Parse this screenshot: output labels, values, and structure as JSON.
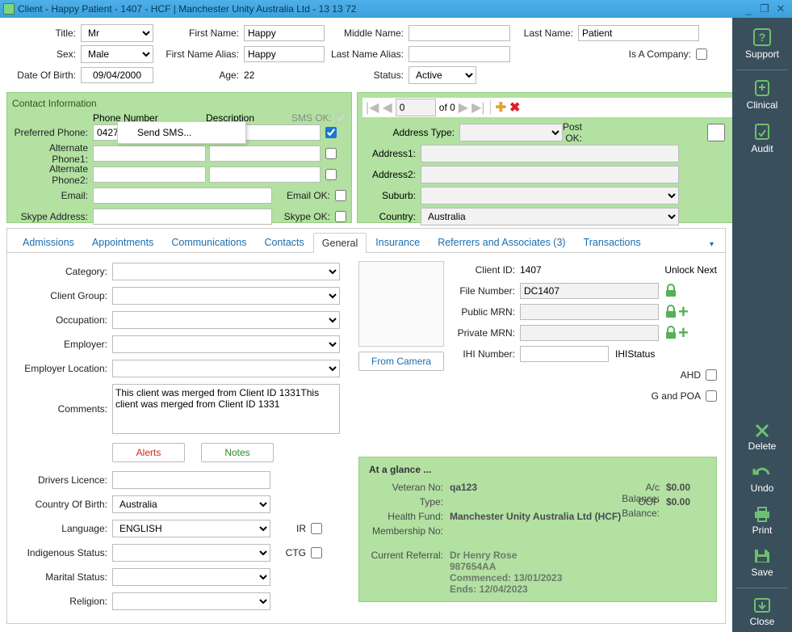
{
  "window": {
    "title": "Client - Happy Patient - 1407 - HCF | Manchester Unity Australia Ltd - 13 13 72"
  },
  "sidebar": {
    "support": "Support",
    "clinical": "Clinical",
    "audit": "Audit",
    "delete": "Delete",
    "undo": "Undo",
    "print": "Print",
    "save": "Save",
    "close": "Close"
  },
  "top": {
    "title_lbl": "Title:",
    "title_val": "Mr",
    "first_name_lbl": "First Name:",
    "first_name_val": "Happy",
    "middle_name_lbl": "Middle Name:",
    "middle_name_val": "",
    "last_name_lbl": "Last Name:",
    "last_name_val": "Patient",
    "sex_lbl": "Sex:",
    "sex_val": "Male",
    "first_alias_lbl": "First Name Alias:",
    "first_alias_val": "Happy",
    "last_alias_lbl": "Last Name Alias:",
    "last_alias_val": "",
    "is_company_lbl": "Is A Company:",
    "dob_lbl": "Date Of Birth:",
    "dob_val": "09/04/2000",
    "age_lbl": "Age:",
    "age_val": "22",
    "status_lbl": "Status:",
    "status_val": "Active"
  },
  "contact": {
    "header": "Contact Information",
    "phone_hdr": "Phone Number",
    "desc_hdr": "Description",
    "sms_ok": "SMS OK:",
    "preferred_lbl": "Preferred Phone:",
    "preferred_val": "0427",
    "alt1_lbl": "Alternate Phone1:",
    "alt2_lbl": "Alternate Phone2:",
    "email_lbl": "Email:",
    "email_ok": "Email OK:",
    "skype_lbl": "Skype Address:",
    "skype_ok": "Skype OK:",
    "sms_menu": "Send SMS..."
  },
  "addr": {
    "page_val": "0",
    "page_of": "of 0",
    "type_lbl": "Address  Type:",
    "post_ok": "Post OK:",
    "a1": "Address1:",
    "a2": "Address2:",
    "suburb": "Suburb:",
    "country": "Country:",
    "country_val": "Australia"
  },
  "tabs": {
    "admissions": "Admissions",
    "appointments": "Appointments",
    "communications": "Communications",
    "contacts": "Contacts",
    "general": "General",
    "insurance": "Insurance",
    "referrers": "Referrers and Associates (3)",
    "transactions": "Transactions"
  },
  "general": {
    "category": "Category:",
    "client_group": "Client Group:",
    "occupation": "Occupation:",
    "employer": "Employer:",
    "employer_loc": "Employer Location:",
    "comments": "Comments:",
    "comments_val": "This client was merged from Client ID 1331This client was merged from Client ID 1331",
    "alerts_btn": "Alerts",
    "notes_btn": "Notes",
    "drivers": "Drivers Licence:",
    "cob": "Country Of Birth:",
    "cob_val": "Australia",
    "language": "Language:",
    "language_val": "ENGLISH",
    "ir": "IR",
    "indigenous": "Indigenous Status:",
    "ctg": "CTG",
    "marital": "Marital Status:",
    "religion": "Religion:",
    "from_camera": "From Camera",
    "client_id_lbl": "Client ID:",
    "client_id_val": "1407",
    "unlock_next": "Unlock Next",
    "file_no_lbl": "File Number:",
    "file_no_val": "DC1407",
    "public_mrn": "Public MRN:",
    "private_mrn": "Private MRN:",
    "ihi_number": "IHI Number:",
    "ihi_status": "IHIStatus",
    "ahd": "AHD",
    "gpoa": "G and POA"
  },
  "glance": {
    "header": "At a glance ...",
    "veteran_lbl": "Veteran No:",
    "veteran_val": "qa123",
    "ac_bal_lbl": "A/c Balance:",
    "ac_bal_val": "$0.00",
    "type_lbl": "Type:",
    "oop_lbl": "OOP Balance:",
    "oop_val": "$0.00",
    "fund_lbl": "Health Fund:",
    "fund_val": "Manchester Unity Australia Ltd (HCF)",
    "member_lbl": "Membership No:",
    "referral_lbl": "Current Referral:",
    "ref_name": "Dr Henry Rose",
    "ref_no": "987654AA",
    "ref_comm": "Commenced: 13/01/2023",
    "ref_ends": "Ends: 12/04/2023"
  }
}
